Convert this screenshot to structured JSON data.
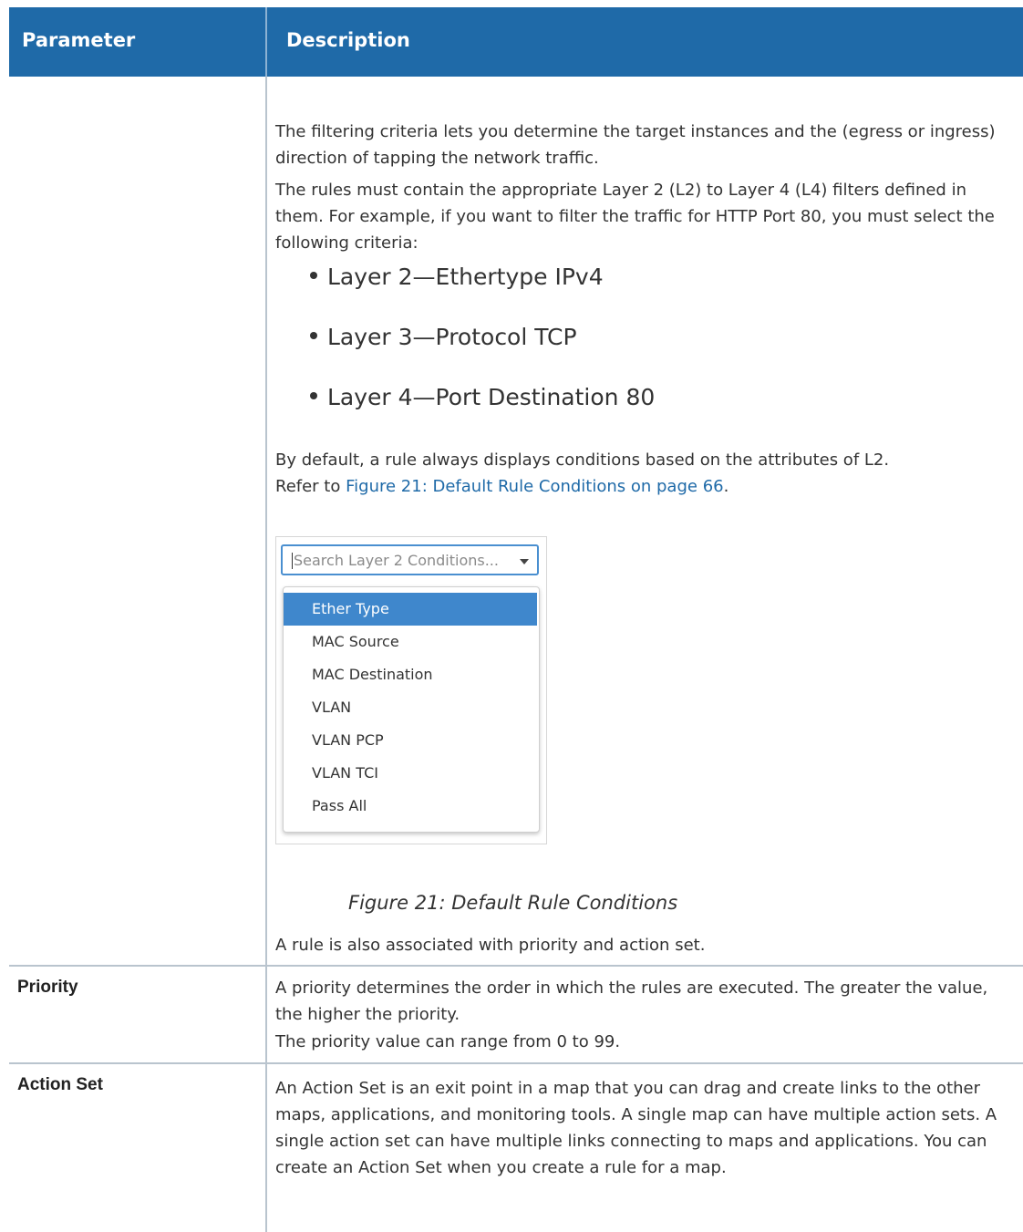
{
  "table": {
    "headers": {
      "parameter": "Parameter",
      "description": "Description"
    }
  },
  "rule_row": {
    "para1": "The filtering criteria lets you determine the target instances and the (egress or ingress) direction of tapping the network traffic.",
    "para2": "The rules must contain the appropriate Layer 2 (L2) to Layer 4 (L4) filters defined in them. For example, if you want to filter the traffic for HTTP Port 80, you must select the following criteria:",
    "bullets": [
      "Layer 2—Ethertype IPv4",
      "Layer 3—Protocol TCP",
      "Layer 4—Port Destination 80"
    ],
    "para3": "By default, a rule always displays conditions based on the attributes of L2.",
    "refer_prefix": "Refer to ",
    "refer_link": "Figure 21: Default Rule Conditions on page 66",
    "refer_suffix": ".",
    "figure": {
      "search_placeholder": "Search Layer 2 Conditions...",
      "options": [
        "Ether Type",
        "MAC Source",
        "MAC Destination",
        "VLAN",
        "VLAN PCP",
        "VLAN TCI",
        "Pass All"
      ],
      "selected_index": 0,
      "caption": "Figure 21: Default Rule Conditions"
    },
    "closing": "A rule is also associated with priority and action set."
  },
  "priority_row": {
    "label": "Priority",
    "para1": "A priority determines the order in which the rules are executed. The greater the value, the higher the priority.",
    "para2": "The priority value can range from 0 to 99."
  },
  "action_row": {
    "label": "Action Set",
    "para1": "An Action Set is an exit point in a map that you can drag and create links to the other maps, applications, and monitoring tools. A single map can have multiple action sets. A single action set can have multiple links connecting to maps and applications. You can create an Action Set when you create a rule for a map."
  },
  "colors": {
    "header_bg": "#1f6aa8",
    "link": "#1f6aa8",
    "selected_option_bg": "#3f87cc",
    "search_border": "#4a8fd0"
  }
}
